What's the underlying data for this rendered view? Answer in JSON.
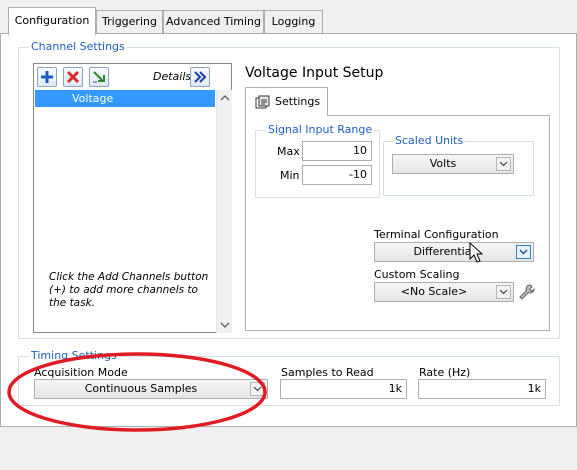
{
  "tabs": [
    {
      "label": "Configuration",
      "active": true
    },
    {
      "label": "Triggering",
      "active": false
    },
    {
      "label": "Advanced Timing",
      "active": false
    },
    {
      "label": "Logging",
      "active": false
    }
  ],
  "channel_settings": {
    "title": "Channel Settings",
    "details_label": "Details",
    "channels": [
      "Voltage"
    ],
    "hint": "Click the Add Channels button (+) to add more channels to the task."
  },
  "voltage_setup": {
    "title": "Voltage Input Setup",
    "settings_tab": "Settings",
    "signal_input_range": {
      "title": "Signal Input Range",
      "max_label": "Max",
      "max_value": "10",
      "min_label": "Min",
      "min_value": "-10"
    },
    "scaled_units": {
      "title": "Scaled Units",
      "value": "Volts"
    },
    "terminal_configuration": {
      "label": "Terminal Configuration",
      "value": "Differential"
    },
    "custom_scaling": {
      "label": "Custom Scaling",
      "value": "<No Scale>"
    }
  },
  "timing_settings": {
    "title": "Timing Settings",
    "acquisition_mode_label": "Acquisition Mode",
    "acquisition_mode_value": "Continuous Samples",
    "samples_to_read_label": "Samples to Read",
    "samples_to_read_value": "1k",
    "rate_label": "Rate (Hz)",
    "rate_value": "1k"
  },
  "colors": {
    "accent_title": "#1f5fbf",
    "selection": "#3399ff",
    "annotation": "#e11b22"
  },
  "icons": [
    "add-channel-icon",
    "remove-channel-icon",
    "rename-channel-icon",
    "expand-details-icon",
    "settings-tab-icon",
    "wrench-icon",
    "mouse-cursor-icon"
  ]
}
